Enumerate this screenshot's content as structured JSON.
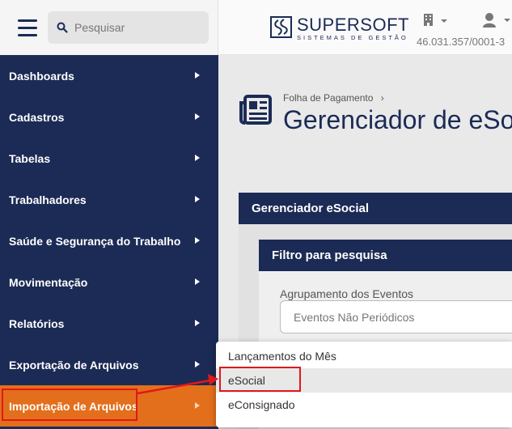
{
  "search": {
    "placeholder": "Pesquisar"
  },
  "sidebar": {
    "items": [
      {
        "label": "Dashboards"
      },
      {
        "label": "Cadastros"
      },
      {
        "label": "Tabelas"
      },
      {
        "label": "Trabalhadores"
      },
      {
        "label": "Saúde e Segurança do Trabalho"
      },
      {
        "label": "Movimentação"
      },
      {
        "label": "Relatórios"
      },
      {
        "label": "Exportação de Arquivos"
      },
      {
        "label": "Importação de Arquivos"
      }
    ],
    "active_color": "#e36f1c",
    "bg_color": "#1b2b55"
  },
  "header": {
    "logo_name": "SUPERSOFT",
    "logo_tagline": "SISTEMAS DE GESTÃO",
    "company_id": "46.031.357/0001-3",
    "icons": [
      "building-icon",
      "user-icon"
    ]
  },
  "page": {
    "breadcrumb": "Folha de Pagamento",
    "title": "Gerenciador de eSoc"
  },
  "panel": {
    "title": "Gerenciador eSocial",
    "filter_title": "Filtro para pesquisa",
    "field_label": "Agrupamento dos Eventos",
    "field_value": "Eventos Não Periódicos"
  },
  "dropdown": {
    "items": [
      {
        "label": "Lançamentos do Mês"
      },
      {
        "label": "eSocial"
      },
      {
        "label": "eConsignado"
      }
    ]
  },
  "annotation_color": "#e01818"
}
